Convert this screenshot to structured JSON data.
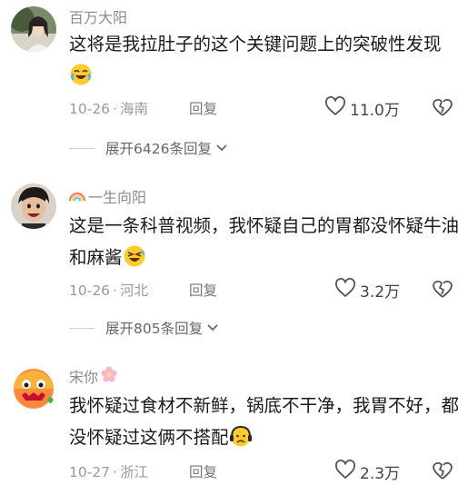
{
  "comments": [
    {
      "username": "百万大阳",
      "text": "这将是我拉肚子的这个关键问题上的突破性发现",
      "date": "10-26",
      "location": "海南",
      "reply": "回复",
      "likes": "11.0万",
      "expand": "展开6426条回复"
    },
    {
      "username": "一生向阳",
      "text": "这是一条科普视频，我怀疑自己的胃都没怀疑牛油和麻酱",
      "date": "10-26",
      "location": "河北",
      "reply": "回复",
      "likes": "3.2万",
      "expand": "展开805条回复"
    },
    {
      "username": "宋你",
      "text": "我怀疑过食材不新鲜，锅底不干净，我胃不好，都没怀疑过这俩不搭配",
      "date": "10-27",
      "location": "浙江",
      "reply": "回复",
      "likes": "2.3万"
    }
  ],
  "separator": "·",
  "colors": {
    "username": "#8a8a8a",
    "meta": "#9a9a9a",
    "text": "#1a1a1a"
  }
}
